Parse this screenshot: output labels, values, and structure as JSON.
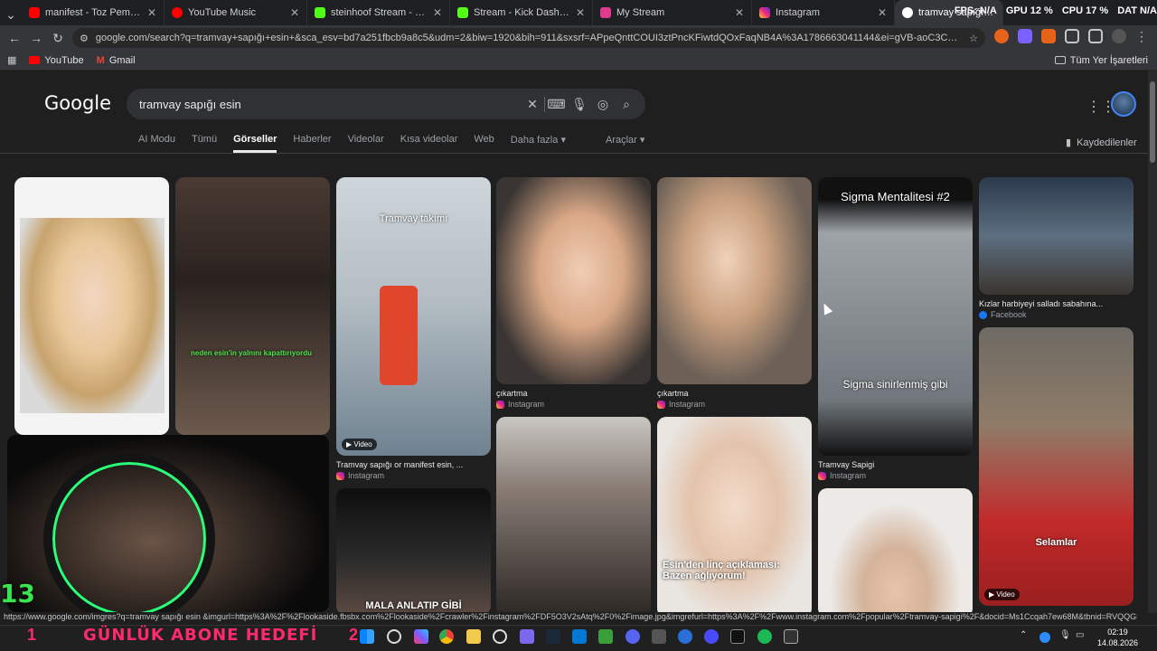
{
  "tabs": [
    {
      "title": "manifest - Toz Pembe | Official M",
      "favicon": "youtube-icon",
      "color": "#ff0000"
    },
    {
      "title": "YouTube Music",
      "favicon": "youtube-music-icon",
      "color": "#ff0000"
    },
    {
      "title": "steinhoof Stream - Watch Live o",
      "favicon": "kick-icon",
      "color": "#53fc18"
    },
    {
      "title": "Stream - Kick Dashboard",
      "favicon": "kick-icon",
      "color": "#53fc18"
    },
    {
      "title": "My Stream",
      "favicon": "stream-icon",
      "color": "#e03a8f"
    },
    {
      "title": "Instagram",
      "favicon": "instagram-icon",
      "color": "#e1306c"
    },
    {
      "title": "tramvay sapığı esin - Google",
      "favicon": "google-icon",
      "color": "#4285f4",
      "active": true
    }
  ],
  "system_monitor": {
    "fps": "FPS: N/A",
    "gpu": "GPU 12 %",
    "cpu": "CPU 17 %",
    "extra": "DAT N/A"
  },
  "omnibox": {
    "url": "google.com/search?q=tramvay+sapığı+esin+&sca_esv=bd7a251fbcb9a8c5&udm=2&biw=1920&bih=911&sxsrf=APpeQnttCOUI3ztPncKFiwtdQOxFaqNB4A%3A1786663041144&ei=gVB-aoC3COXzwPAP857eGQ&ved=0ahUKEwjA-..."
  },
  "bookmarks": {
    "items": [
      {
        "label": "YouTube",
        "icon": "youtube-icon"
      },
      {
        "label": "Gmail",
        "icon": "gmail-icon"
      }
    ],
    "all_bookmarks": "Tüm Yer İşaretleri"
  },
  "google": {
    "logo": "Google",
    "query": "tramvay sapığı esin",
    "nav": [
      "AI Modu",
      "Tümü",
      "Görseller",
      "Haberler",
      "Videolar",
      "Kısa videolar",
      "Web",
      "Daha fazla"
    ],
    "selected_nav": "Görseller",
    "tools": "Araçlar",
    "saved": "Kaydedilenler"
  },
  "results": [
    {
      "caption": "",
      "source": ""
    },
    {
      "caption": "",
      "source": "",
      "overlay": "neden esin'in yalnını kapattırıyordu"
    },
    {
      "caption": "Tramvay sapığı or manifest esin, ...",
      "source": "Instagram",
      "overlay": "Tramvay takımı",
      "badge": "Video"
    },
    {
      "caption": "çıkartma",
      "source": "Instagram"
    },
    {
      "caption": "çıkartma",
      "source": "Instagram"
    },
    {
      "caption": "Tramvay Sapigi",
      "source": "Instagram",
      "overlay_top": "Sigma Mentalitesi #2",
      "overlay_bottom": "Sigma sinirlenmiş gibi"
    },
    {
      "caption": "Kızlar harbiyeyi salladı sabahına...",
      "source": "Facebook"
    },
    {
      "caption": "",
      "source": "",
      "overlay": "MALA ANLATIP GİBİ"
    },
    {
      "caption": "",
      "source": ""
    },
    {
      "caption": "",
      "source": "",
      "overlay": "Esin'den linç açıklaması: Bazen ağlıyorum!"
    },
    {
      "caption": "",
      "source": ""
    },
    {
      "caption": "",
      "source": "",
      "overlay": "Selamlar",
      "badge": "Video"
    }
  ],
  "status_url": "https://www.google.com/imgres?q=tramvay sapığı esin &imgurl=https%3A%2F%2Flookaside.fbsbx.com%2Flookaside%2Fcrawler%2Finstagram%2FDF5O3V2sAtq%2F0%2Fimage.jpg&imgrefurl=https%3A%2F%2Fwww.instagram.com%2Fpopular%2Ftramvay-sapigi%2F&docid=Ms1Ccqah7ew68M&tbnid=RVQQGFoNJCYqZM&vet=12ahUKEwi8ktPD3p6W...",
  "stream_overlay": {
    "goal_text": "GÜNLÜK ABONE HEDEFİ",
    "goal_left": "1",
    "goal_right": "2",
    "counter": "13"
  },
  "clock": {
    "time": "02:19",
    "date": "14.08.2026"
  }
}
